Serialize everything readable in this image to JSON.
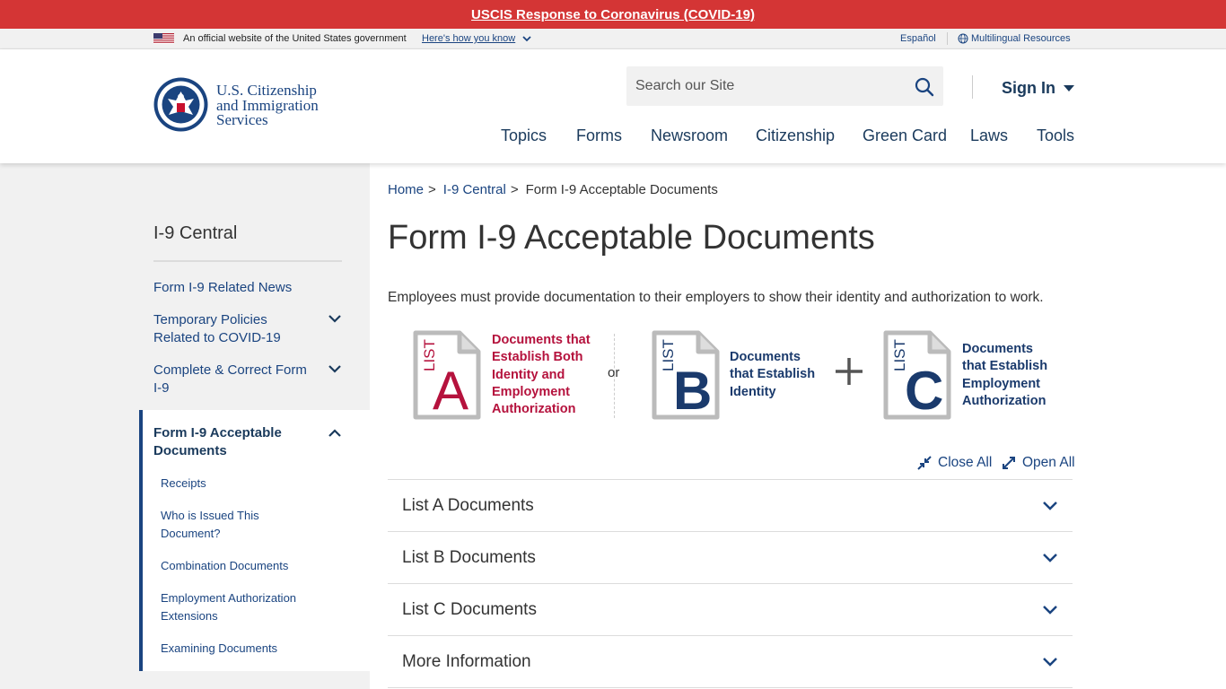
{
  "alert": {
    "text": "USCIS Response to Coronavirus (COVID-19)"
  },
  "gov_banner": {
    "official_text": "An official website of the United States government",
    "how_link": "Here's how you know",
    "espanol": "Español",
    "multilingual": "Multilingual Resources"
  },
  "header": {
    "logo_lines": [
      "U.S. Citizenship",
      "and Immigration",
      "Services"
    ],
    "search_placeholder": "Search our Site",
    "signin": "Sign In",
    "nav": [
      "Topics",
      "Forms",
      "Newsroom",
      "Citizenship",
      "Green Card",
      "Laws",
      "Tools"
    ]
  },
  "sidebar": {
    "title": "I-9 Central",
    "items": [
      "Form I-9 Related News",
      "Temporary Policies Related to COVID-19",
      "Complete & Correct Form I-9"
    ],
    "active": {
      "title": "Form I-9 Acceptable Documents",
      "subitems": [
        "Receipts",
        "Who is Issued This Document?",
        "Combination Documents",
        "Employment Authorization Extensions",
        "Examining Documents"
      ]
    }
  },
  "breadcrumb": {
    "home": "Home",
    "parent": "I-9 Central",
    "current": "Form I-9 Acceptable Documents",
    "separator": ">"
  },
  "main": {
    "title": "Form I-9 Acceptable Documents",
    "intro": "Employees must provide documentation to their employers to show their identity and authorization to work.",
    "lists": [
      {
        "tag": "LIST",
        "letter": "A",
        "label_lines": [
          "Documents that",
          "Establish Both",
          "Identity and",
          "Employment",
          "Authorization"
        ],
        "color": "#b5123d"
      },
      {
        "tag": "LIST",
        "letter": "B",
        "label_lines": [
          "Documents",
          "that Establish",
          "Identity"
        ],
        "color": "#1a3a6c"
      },
      {
        "tag": "LIST",
        "letter": "C",
        "label_lines": [
          "Documents",
          "that Establish",
          "Employment",
          "Authorization"
        ],
        "color": "#1a3a6c"
      }
    ],
    "or_text": "or",
    "close_all": "Close All",
    "open_all": "Open All",
    "accordion": [
      "List A Documents",
      "List B Documents",
      "List C Documents",
      "More Information"
    ]
  }
}
